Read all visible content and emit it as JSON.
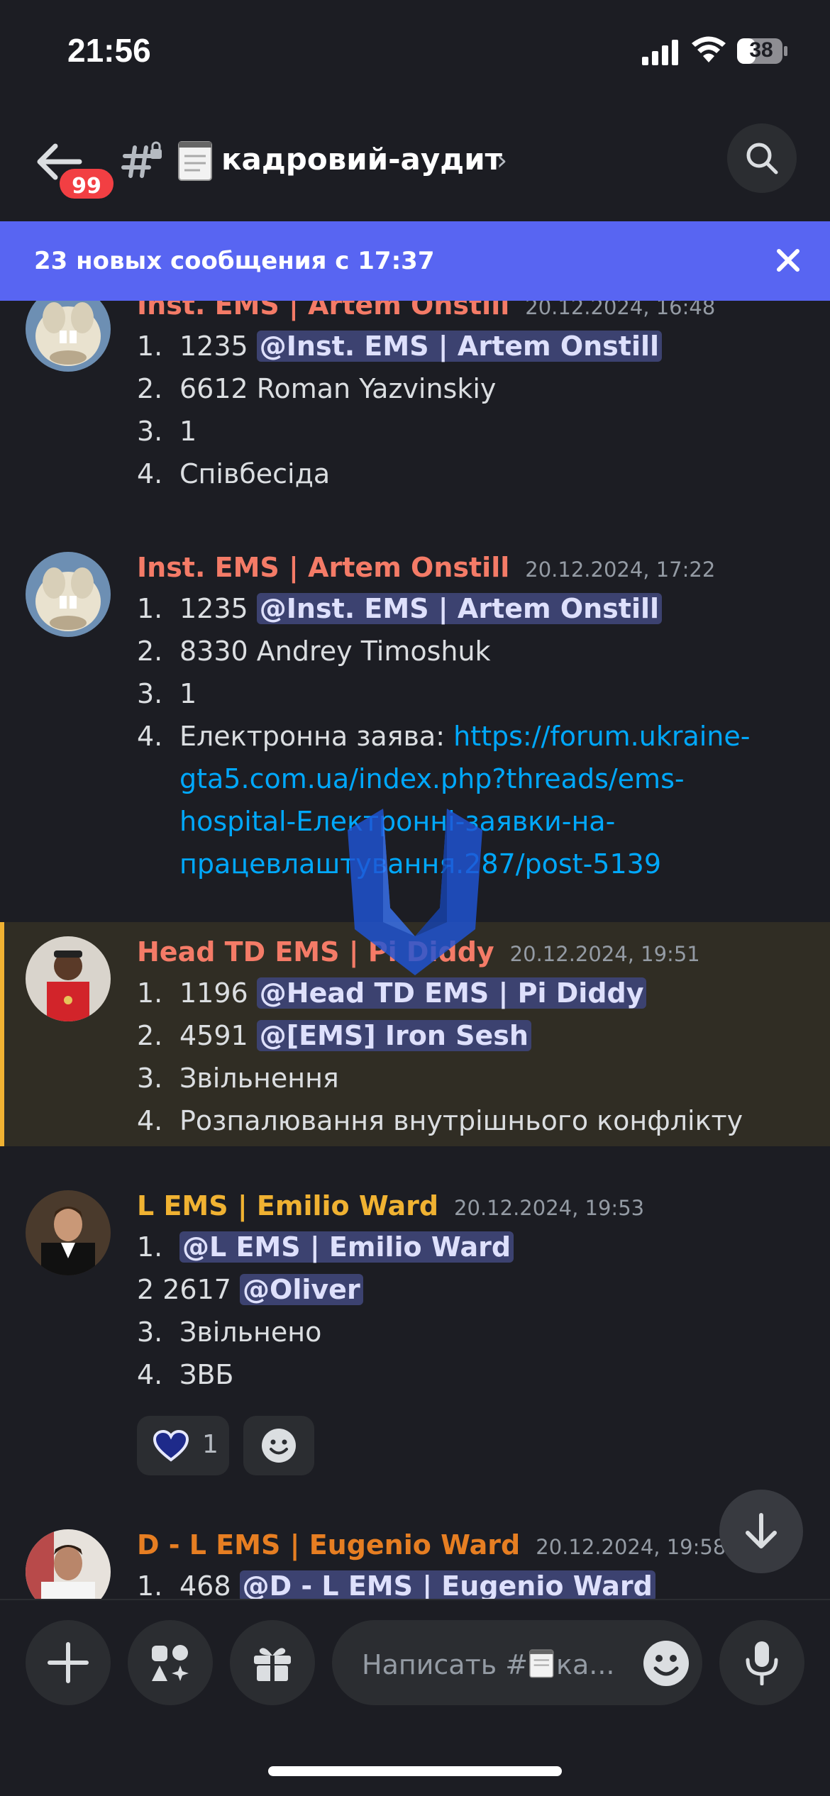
{
  "status_bar": {
    "time": "21:56",
    "battery": "38"
  },
  "header": {
    "unread_badge": "99",
    "channel_name": "кадровий-аудит",
    "chevron": "›"
  },
  "banner": {
    "text": "23 новых сообщения с 17:37"
  },
  "messages": [
    {
      "author": "Inst. EMS | Artem Onstill",
      "timestamp": "20.12.2024, 16:48",
      "author_color": "#f47b67",
      "lines": [
        {
          "num": "1.",
          "text": "1235 ",
          "mention": "@Inst. EMS | Artem Onstill"
        },
        {
          "num": "2.",
          "text": "6612 Roman Yazvinskiy"
        },
        {
          "num": "3.",
          "text": "1"
        },
        {
          "num": "4.",
          "text": "Співбесіда"
        }
      ]
    },
    {
      "author": "Inst. EMS | Artem Onstill",
      "timestamp": "20.12.2024, 17:22",
      "author_color": "#f47b67",
      "lines": [
        {
          "num": "1.",
          "text": "1235 ",
          "mention": "@Inst. EMS | Artem Onstill"
        },
        {
          "num": "2.",
          "text": "8330 Andrey Timoshuk"
        },
        {
          "num": "3.",
          "text": "1"
        },
        {
          "num": "4.",
          "text": "Електронна заява: ",
          "link": "https://forum.ukraine-"
        }
      ],
      "link_continuation": [
        "gta5.com.ua/index.php?threads/ems-",
        "hospital-Електронні-заявки-на-",
        "працевлаштування.287/post-5139"
      ]
    },
    {
      "author": "Head TD EMS | Pi Diddy",
      "timestamp": "20.12.2024, 19:51",
      "author_color": "#f47b67",
      "lines": [
        {
          "num": "1.",
          "text": "1196 ",
          "mention": "@Head TD EMS | Pi Diddy"
        },
        {
          "num": "2.",
          "text": "4591  ",
          "mention": "@[EMS] Iron Sesh"
        },
        {
          "num": "3.",
          "text": "Звільнення"
        },
        {
          "num": "4.",
          "text": "Розпалювання внутрішнього конфлікту"
        }
      ]
    },
    {
      "author": "L EMS | Emilio Ward",
      "timestamp": "20.12.2024, 19:53",
      "author_color": "#f0b232",
      "lines": [
        {
          "num": "1.",
          "text": "",
          "mention": "@L EMS | Emilio Ward"
        },
        {
          "num": "",
          "text": "2 2617 ",
          "mention": "@Oliver"
        },
        {
          "num": "3.",
          "text": "Звільнено"
        },
        {
          "num": "4.",
          "text": "ЗВБ"
        }
      ],
      "reaction": {
        "icon": "heart-icon",
        "count": "1"
      }
    },
    {
      "author": "D - L EMS | Eugenio Ward",
      "timestamp": "20.12.2024, 19:58",
      "author_color": "#e67e22",
      "lines": [
        {
          "num": "1.",
          "text": "468 ",
          "mention": "@D - L EMS | Eugenio Ward"
        }
      ]
    }
  ],
  "composer": {
    "placeholder": "Написать #",
    "placeholder_suffix": "ка..."
  },
  "colors": {
    "accent": "#5865f2",
    "mention_bg": "#3c4270",
    "link": "#00a8fc",
    "highlight_bar": "#f0b232"
  }
}
